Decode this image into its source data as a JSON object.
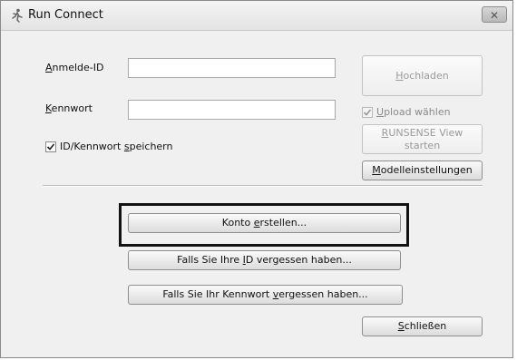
{
  "window": {
    "title": "Run Connect",
    "close_glyph": "✕",
    "app_icon": "runner-icon"
  },
  "form": {
    "login_id_label_hotkey": "A",
    "login_id_label_rest": "nmelde-ID",
    "login_id_value": "",
    "password_label_hotkey": "K",
    "password_label_rest": "ennwort",
    "password_value": "",
    "save_credentials_pre": "ID/Kennwort ",
    "save_credentials_hotkey": "s",
    "save_credentials_post": "peichern",
    "save_credentials_checked": true
  },
  "right_panel": {
    "upload_hotkey": "H",
    "upload_rest": "ochladen",
    "select_upload_hotkey": "U",
    "select_upload_rest": "pload wählen",
    "select_upload_checked": true,
    "runsense_line1_hotkey": "R",
    "runsense_line1_rest": "UNSENSE View",
    "runsense_line2": "starten",
    "model_settings_hotkey": "M",
    "model_settings_rest": "odelleinstellungen"
  },
  "actions": {
    "create_account_pre": "Konto ",
    "create_account_hotkey": "e",
    "create_account_post": "rstellen...",
    "forgot_id_pre": "Falls Sie Ihre ",
    "forgot_id_hotkey": "I",
    "forgot_id_post": "D vergessen haben...",
    "forgot_pw_pre": "Falls Sie Ihr Kennwort ",
    "forgot_pw_hotkey": "v",
    "forgot_pw_post": "ergessen haben...",
    "close_hotkey": "S",
    "close_rest": "chließen"
  }
}
